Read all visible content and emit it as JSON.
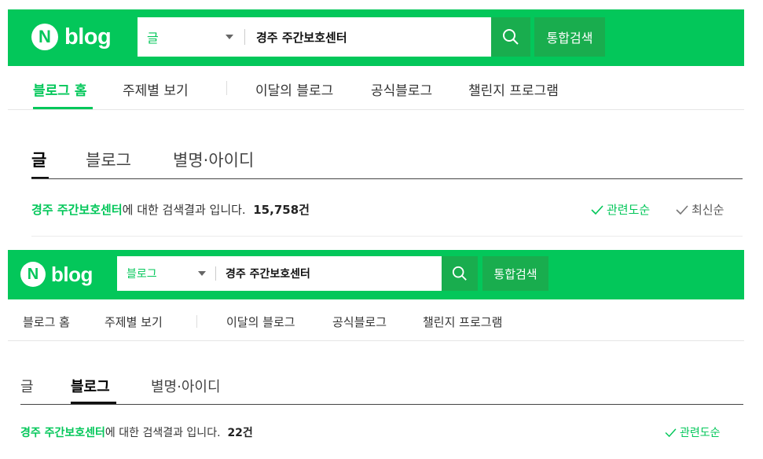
{
  "top": {
    "logo_n": "N",
    "logo_text": "blog",
    "category": "글",
    "query": "경주 주간보호센터",
    "total_search_label": "통합검색",
    "search_icon": "search-icon",
    "nav": [
      "블로그 홈",
      "주제별 보기",
      "이달의 블로그",
      "공식블로그",
      "챌린지 프로그램"
    ],
    "tabs": [
      "글",
      "블로그",
      "별명·아이디"
    ],
    "result": {
      "keyword": "경주 주간보호센터",
      "suffix": "에 대한 검색결과 입니다.",
      "count": "15,758건"
    },
    "sort": [
      "관련도순",
      "최신순"
    ]
  },
  "bottom": {
    "logo_n": "N",
    "logo_text": "blog",
    "category": "블로그",
    "query": "경주 주간보호센터",
    "total_search_label": "통합검색",
    "search_icon": "search-icon",
    "nav": [
      "블로그 홈",
      "주제별 보기",
      "이달의 블로그",
      "공식블로그",
      "챌린지 프로그램"
    ],
    "tabs": [
      "글",
      "블로그",
      "별명·아이디"
    ],
    "result": {
      "keyword": "경주 주간보호센터",
      "suffix": "에 대한 검색결과 입니다.",
      "count": "22건"
    },
    "sort": [
      "관련도순"
    ]
  },
  "colors": {
    "brand_green": "#03c75a",
    "button_green": "#19ad4e"
  }
}
